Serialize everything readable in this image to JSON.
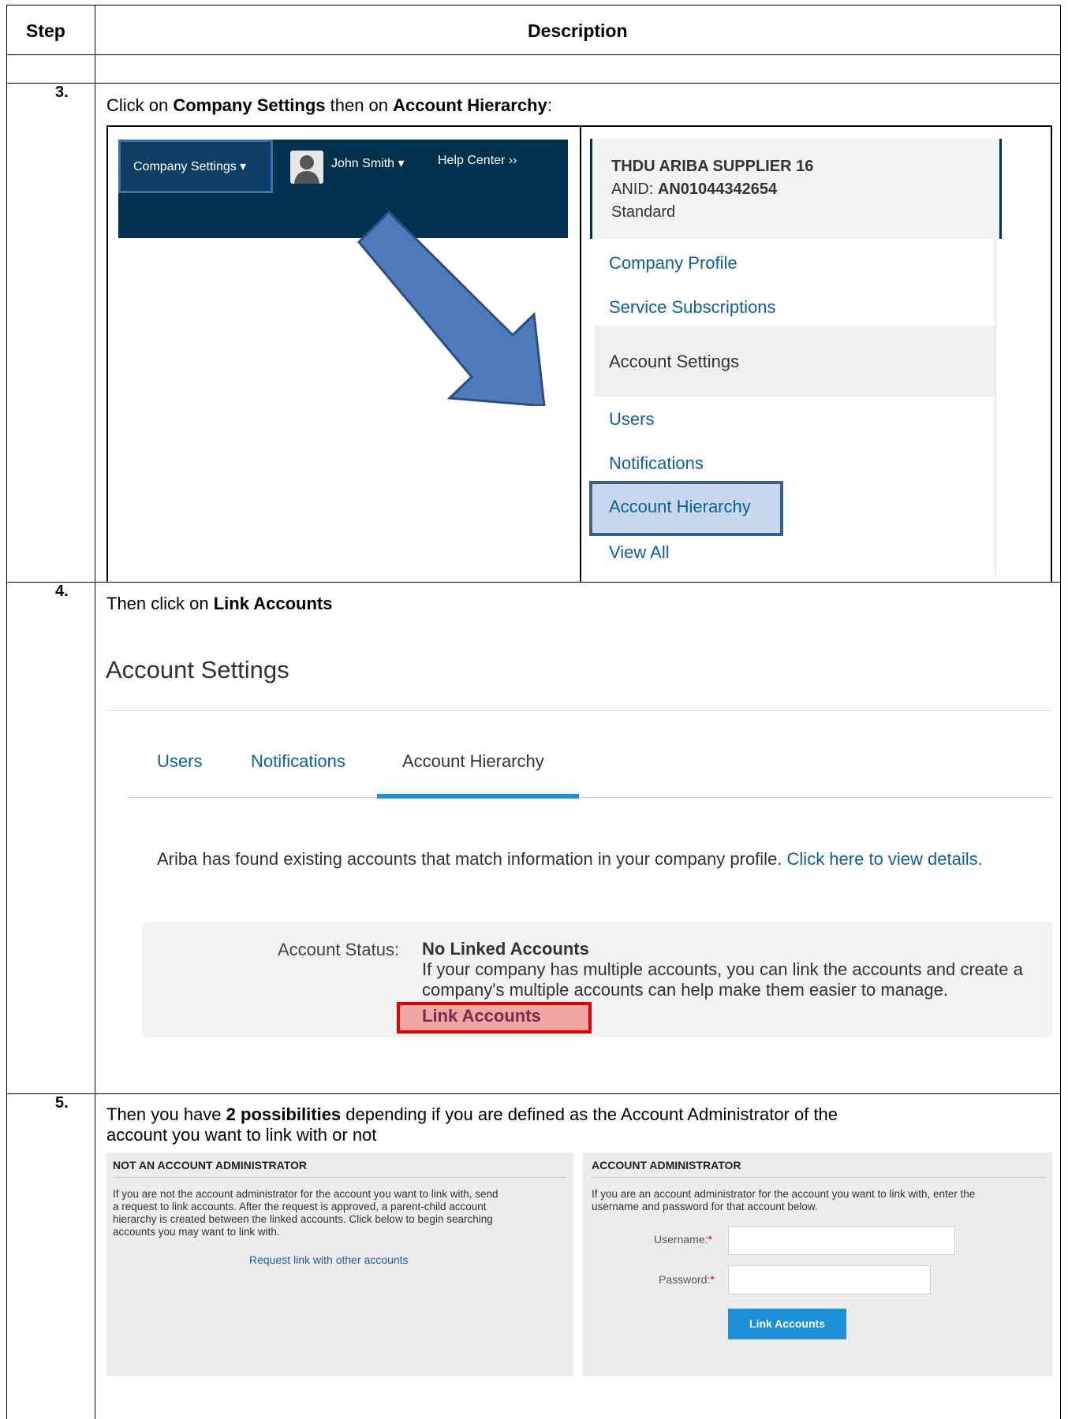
{
  "table": {
    "header_step": "Step",
    "header_description": "Description"
  },
  "step3": {
    "number": "3.",
    "instruction_prefix": "Click on ",
    "instruction_bold1": "Company Settings",
    "instruction_mid": " then on ",
    "instruction_bold2": "Account Hierarchy",
    "instruction_suffix": ":",
    "nav": {
      "company_settings": "Company Settings ▾",
      "user_name": "John Smith ▾",
      "help_center": "Help Center ››"
    },
    "dropdown": {
      "company_name": "THDU ARIBA SUPPLIER 16",
      "anid_label": "ANID: ",
      "anid_value": "AN01044342654",
      "plan": "Standard",
      "items": [
        "Company Profile",
        "Service Subscriptions",
        "Account Settings",
        "Users",
        "Notifications",
        "Account Hierarchy",
        "View All"
      ]
    }
  },
  "step4": {
    "number": "4.",
    "instruction_prefix": "Then click on ",
    "instruction_bold": "Link Accounts",
    "page_title": "Account Settings",
    "tabs": [
      "Users",
      "Notifications",
      "Account Hierarchy"
    ],
    "message": "Ariba has found existing accounts that match information in your company profile. ",
    "message_link": "Click here to view details.",
    "status_label": "Account Status:",
    "status_value": "No Linked Accounts",
    "status_line1": "If your company has multiple accounts, you can link the accounts and create a",
    "status_line2": "company's multiple accounts can help make them easier to manage.",
    "link_accounts": "Link Accounts"
  },
  "step5": {
    "number": "5.",
    "instruction_prefix": "Then you have ",
    "instruction_bold": "2 possibilities",
    "instruction_suffix": " depending if you are defined as the Account Administrator of the",
    "instruction_line2": "account you want to link with or not",
    "left_panel": {
      "title": "NOT AN ACCOUNT ADMINISTRATOR",
      "text": [
        "If you are not the account administrator for the account you want to link with, send",
        "a request to link accounts. After the request is approved, a parent-child account",
        "hierarchy is created between the linked accounts. Click below to begin searching",
        "accounts you may want to link with."
      ],
      "link": "Request link with other accounts"
    },
    "right_panel": {
      "title": "ACCOUNT ADMINISTRATOR",
      "text": [
        "If you are an account administrator for the account you want to link with, enter the",
        "username and password for that account below."
      ],
      "username_label": "Username:",
      "password_label": "Password:",
      "required_mark": "*",
      "button": "Link Accounts"
    }
  }
}
